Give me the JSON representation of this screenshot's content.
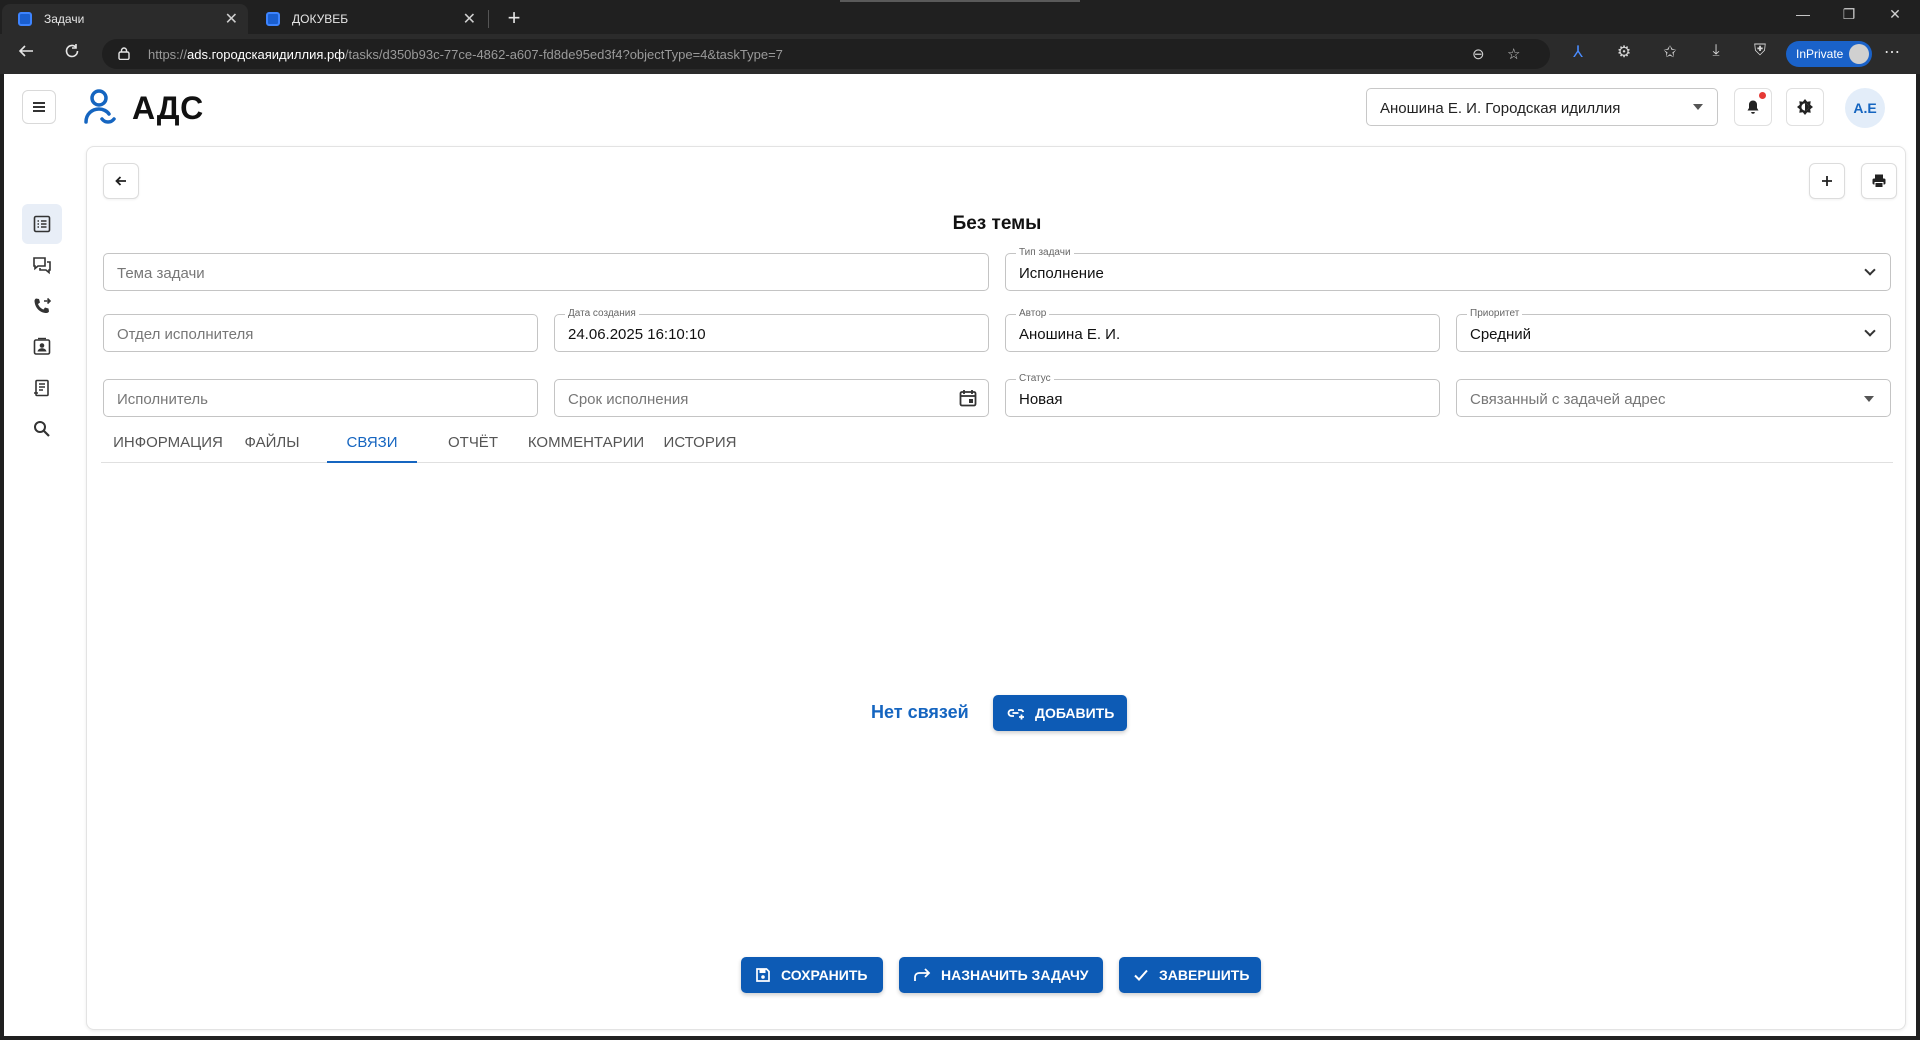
{
  "browser": {
    "tabs": [
      {
        "label": "Задачи"
      },
      {
        "label": "ДОКУВЕБ"
      }
    ],
    "url_prefix": "https://",
    "url_host": "ads.городскаяидиллия.рф",
    "url_path": "/tasks/d350b93c-77ce-4862-a607-fd8de95ed3f4?objectType=4&taskType=7",
    "inprivate_label": "InPrivate"
  },
  "header": {
    "brand": "АДС",
    "org_select": "Аношина Е. И. Городская идиллия",
    "avatar_initials": "А.Е"
  },
  "sidebar": {
    "items": [
      {
        "icon": "task-list-icon",
        "active": true
      },
      {
        "icon": "chat-icon",
        "active": false
      },
      {
        "icon": "phone-forward-icon",
        "active": false
      },
      {
        "icon": "contacts-icon",
        "active": false
      },
      {
        "icon": "document-icon",
        "active": false
      },
      {
        "icon": "search-icon",
        "active": false
      }
    ]
  },
  "task": {
    "title": "Без темы",
    "fields": {
      "subject": {
        "placeholder": "Тема задачи"
      },
      "task_type": {
        "label": "Тип задачи",
        "value": "Исполнение"
      },
      "department": {
        "placeholder": "Отдел исполнителя"
      },
      "created": {
        "label": "Дата создания",
        "value": "24.06.2025 16:10:10"
      },
      "author": {
        "label": "Автор",
        "value": "Аношина Е. И."
      },
      "priority": {
        "label": "Приоритет",
        "value": "Средний"
      },
      "executor": {
        "placeholder": "Исполнитель"
      },
      "deadline": {
        "placeholder": "Срок исполнения"
      },
      "status": {
        "label": "Статус",
        "value": "Новая"
      },
      "address": {
        "placeholder": "Связанный с задачей адрес"
      }
    },
    "tabs": [
      {
        "label": "Информация"
      },
      {
        "label": "Файлы"
      },
      {
        "label": "Связи",
        "active": true
      },
      {
        "label": "Отчёт"
      },
      {
        "label": "Комментарии"
      },
      {
        "label": "История"
      }
    ],
    "links": {
      "empty_text": "Нет связей",
      "add_label": "Добавить"
    },
    "actions": {
      "save": "Сохранить",
      "assign": "Назначить задачу",
      "complete": "Завершить"
    }
  },
  "colors": {
    "accent": "#1565c0",
    "button": "#0d5bb5",
    "notification_dot": "#e53935"
  }
}
